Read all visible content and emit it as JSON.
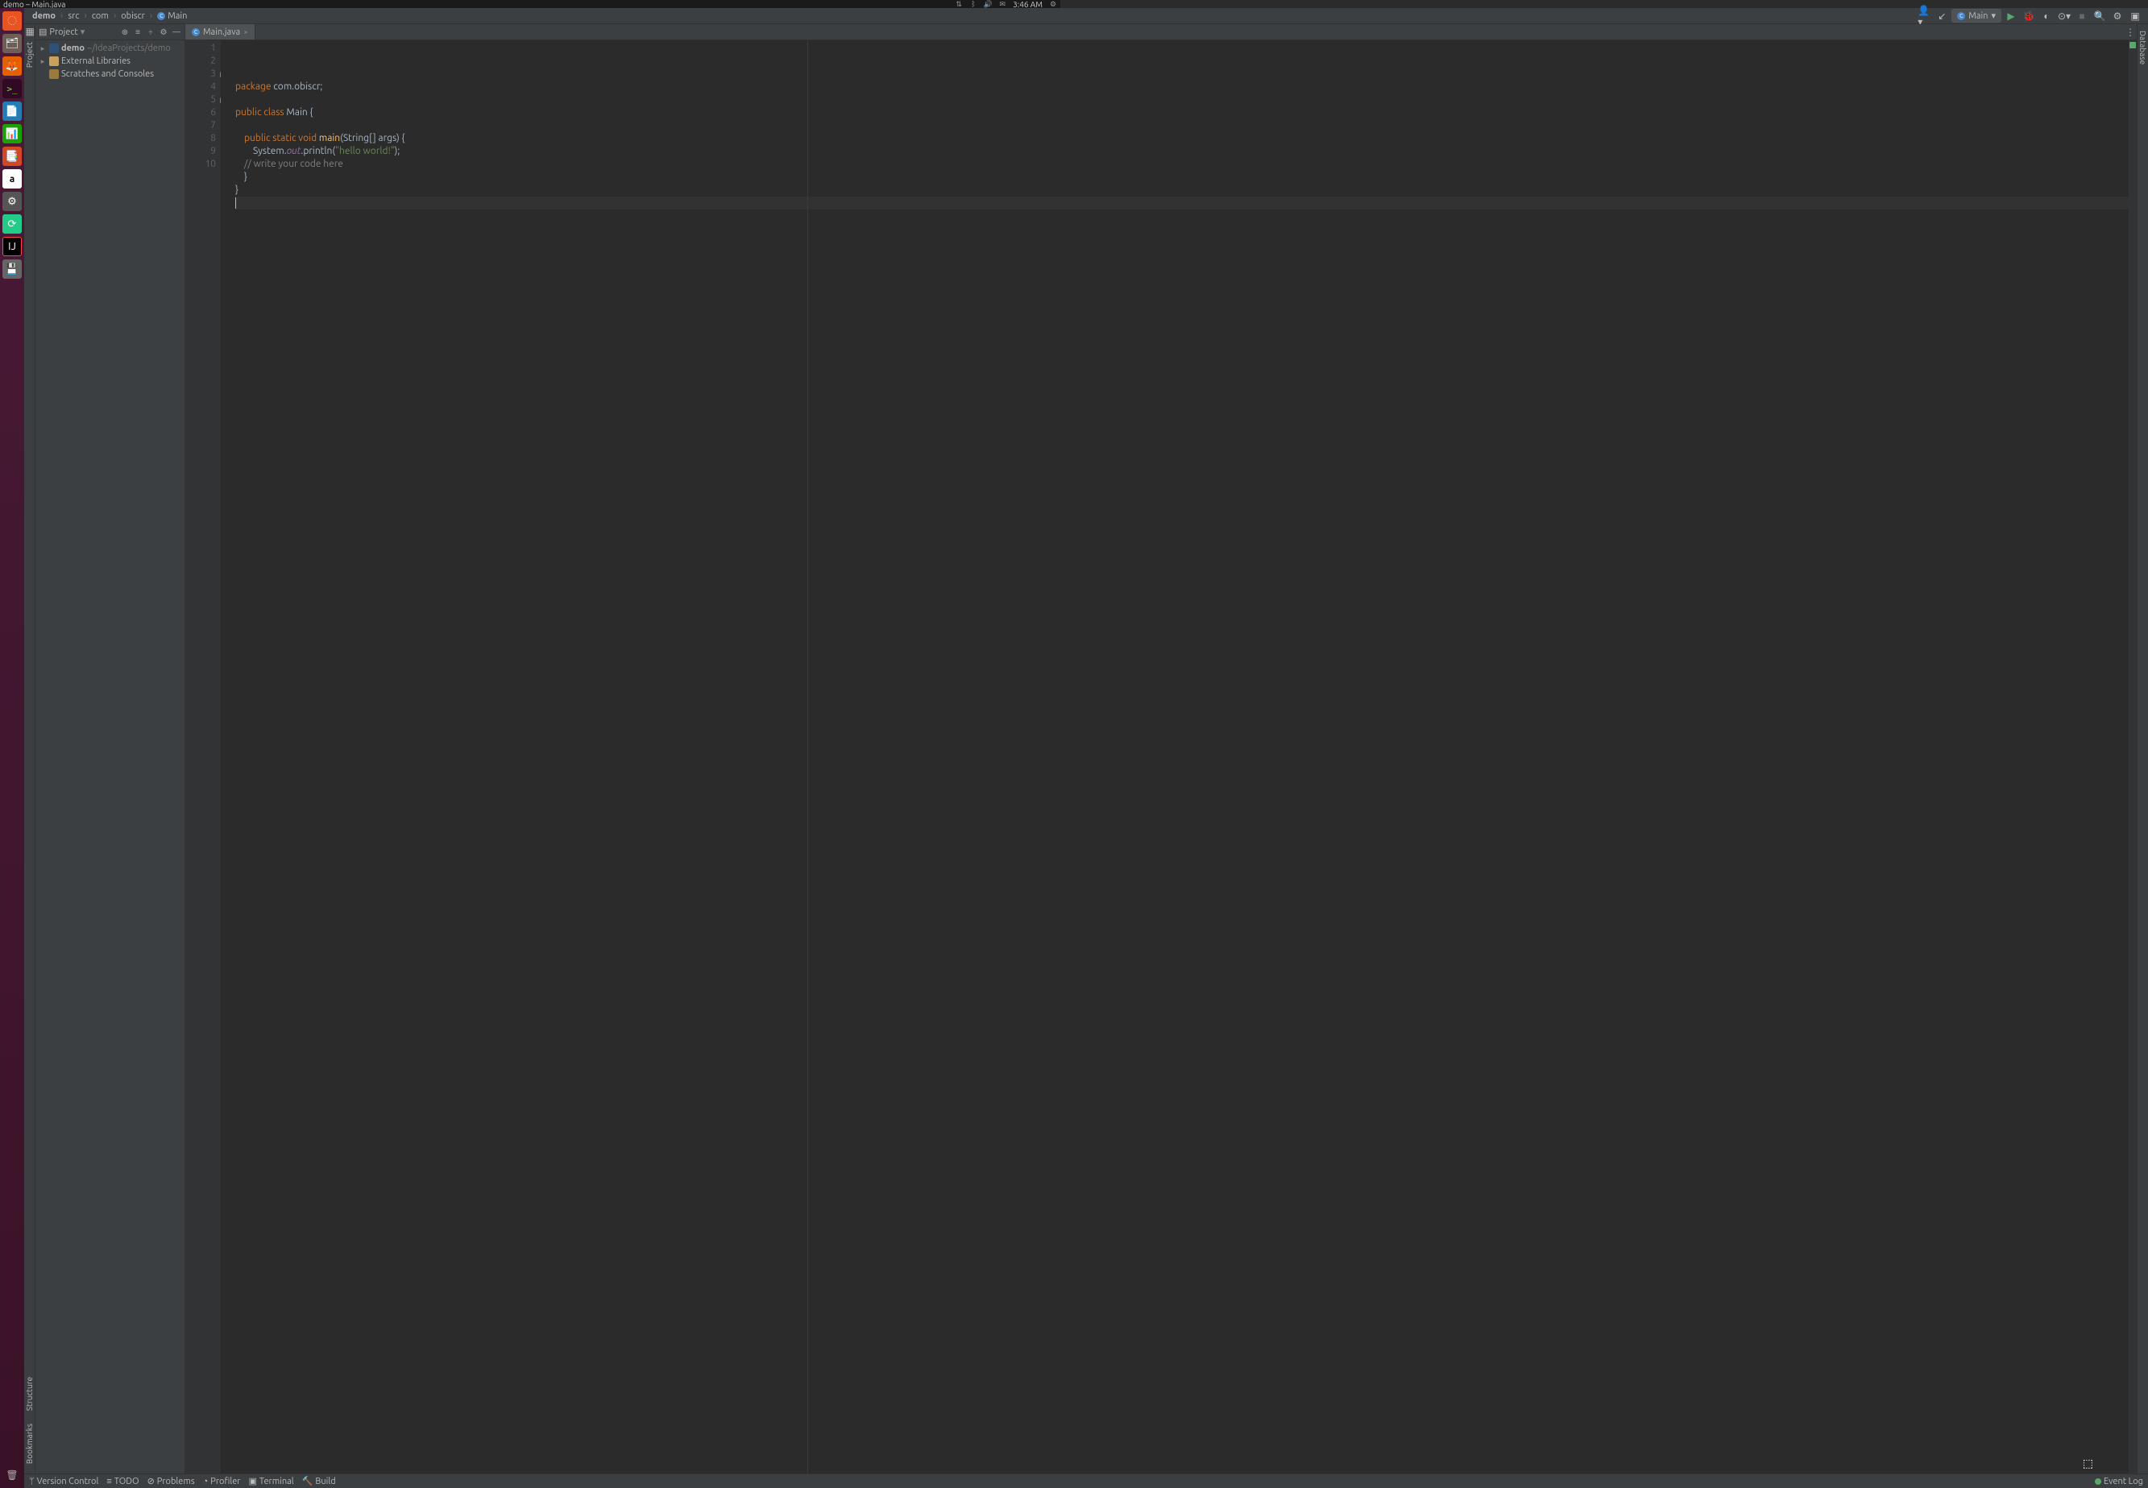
{
  "os": {
    "title": "demo – Main.java",
    "time": "3:46 AM"
  },
  "breadcrumb": [
    "demo",
    "src",
    "com",
    "obiscr",
    "Main"
  ],
  "runConfig": {
    "label": "Main"
  },
  "projectPanel": {
    "title": "Project",
    "root": {
      "name": "demo",
      "path": "~/IdeaProjects/demo"
    },
    "externalLibs": "External Libraries",
    "scratches": "Scratches and Consoles"
  },
  "leftStrip": {
    "project": "Project",
    "bookmarks": "Bookmarks",
    "structure": "Structure"
  },
  "rightStrip": {
    "database": "Database"
  },
  "tabs": [
    {
      "label": "Main.java"
    }
  ],
  "code": {
    "lines": [
      {
        "n": 1,
        "seg": [
          [
            "kw",
            "package "
          ],
          [
            "",
            "com.obiscr"
          ],
          [
            "",
            ";"
          ]
        ]
      },
      {
        "n": 2,
        "seg": []
      },
      {
        "n": 3,
        "run": true,
        "seg": [
          [
            "kw",
            "public class "
          ],
          [
            "",
            "Main {"
          ]
        ]
      },
      {
        "n": 4,
        "seg": []
      },
      {
        "n": 5,
        "run": true,
        "seg": [
          [
            "",
            "    "
          ],
          [
            "kw",
            "public static void "
          ],
          [
            "fn",
            "main"
          ],
          [
            "",
            "(String[] args) {"
          ]
        ]
      },
      {
        "n": 6,
        "seg": [
          [
            "",
            "        System."
          ],
          [
            "fld",
            "out"
          ],
          [
            "",
            ".println("
          ],
          [
            "str",
            "\"hello world!\""
          ],
          [
            "",
            ");"
          ]
        ]
      },
      {
        "n": 7,
        "seg": [
          [
            "cm",
            "    // write your code here"
          ]
        ]
      },
      {
        "n": 8,
        "seg": [
          [
            "",
            "    }"
          ]
        ]
      },
      {
        "n": 9,
        "seg": [
          [
            "",
            "}"
          ]
        ]
      },
      {
        "n": 10,
        "current": true,
        "seg": []
      }
    ]
  },
  "status": {
    "vcs": "Version Control",
    "todo": "TODO",
    "problems": "Problems",
    "profiler": "Profiler",
    "terminal": "Terminal",
    "build": "Build",
    "eventLog": "Event Log"
  }
}
